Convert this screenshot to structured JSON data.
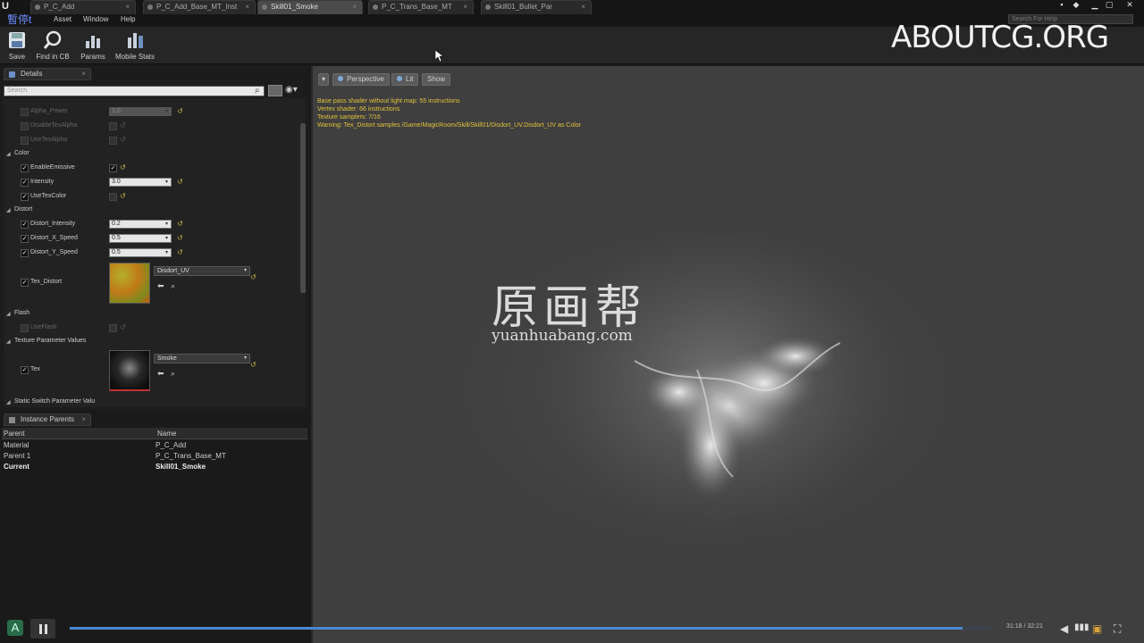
{
  "tabs": [
    {
      "label": "P_C_Add"
    },
    {
      "label": "P_C_Add_Base_MT_Inst"
    },
    {
      "label": "Skill01_Smoke"
    },
    {
      "label": "P_C_Trans_Base_MT"
    },
    {
      "label": "Skill01_Bullet_Par"
    }
  ],
  "menu": {
    "file": "暫停t",
    "asset": "Asset",
    "window": "Window",
    "help": "Help"
  },
  "search_help_placeholder": "Search For Help",
  "toolbar": {
    "save": "Save",
    "find_in_cb": "Find in CB",
    "params": "Params",
    "mobile_stats": "Mobile Stats"
  },
  "watermark_top": "ABOUTCG.ORG",
  "details": {
    "tab_label": "Details",
    "search_placeholder": "Search",
    "rows": {
      "alpha_power": {
        "label": "Alpha_Power",
        "value": "1.0"
      },
      "disable_tex_alpha": {
        "label": "DisableTexAlpha"
      },
      "use_tex_alpha": {
        "label": "UseTexAlpha"
      },
      "cat_color": "Color",
      "enable_emissive": {
        "label": "EnableEmissive",
        "checked": true
      },
      "intensity": {
        "label": "Intensity",
        "value": "3.0"
      },
      "use_tex_color": {
        "label": "UseTexColor",
        "checked": false
      },
      "cat_distort": "Distort",
      "distort_intensity": {
        "label": "Distort_Intensity",
        "value": "0.2"
      },
      "distort_x_speed": {
        "label": "Distort_X_Speed",
        "value": "0.5"
      },
      "distort_y_speed": {
        "label": "Distort_Y_Speed",
        "value": "0.5"
      },
      "tex_distort": {
        "label": "Tex_Distort",
        "asset": "Disdort_UV"
      },
      "cat_flash": "Flash",
      "use_flash": {
        "label": "UseFlash"
      },
      "cat_texture_params": "Texture Parameter Values",
      "tex": {
        "label": "Tex",
        "asset": "Smoke"
      },
      "cat_static_switch": "Static Switch Parameter Valu"
    }
  },
  "instance_parents": {
    "tab_label": "Instance Parents",
    "columns": [
      "Parent",
      "Name"
    ],
    "rows": [
      {
        "parent": "Material",
        "name": "P_C_Add"
      },
      {
        "parent": "Parent 1",
        "name": "P_C_Trans_Base_MT"
      },
      {
        "parent": "Current",
        "name": "Skill01_Smoke"
      }
    ]
  },
  "viewport": {
    "perspective": "Perspective",
    "lit": "Lit",
    "show": "Show",
    "stats": [
      "Base pass shader without light map: 55 instructions",
      "Vertex shader: 66 instructions",
      "Texture samplers: 7/16",
      "Warning: Tex_Distort samples /Game/MagicRoom/Skill/Skill01/Disdort_UV.Disdort_UV as Color"
    ]
  },
  "watermark_cn": "原画帮",
  "watermark_cn_url": "yuanhuabang.com",
  "player": {
    "logo": "A",
    "time": "31:18 / 32:21",
    "progress_fraction": 0.97
  },
  "colors": {
    "accent_blue": "#4a88d4",
    "warning_yellow": "#e3c23a",
    "reset_yellow": "#c8b44c"
  }
}
